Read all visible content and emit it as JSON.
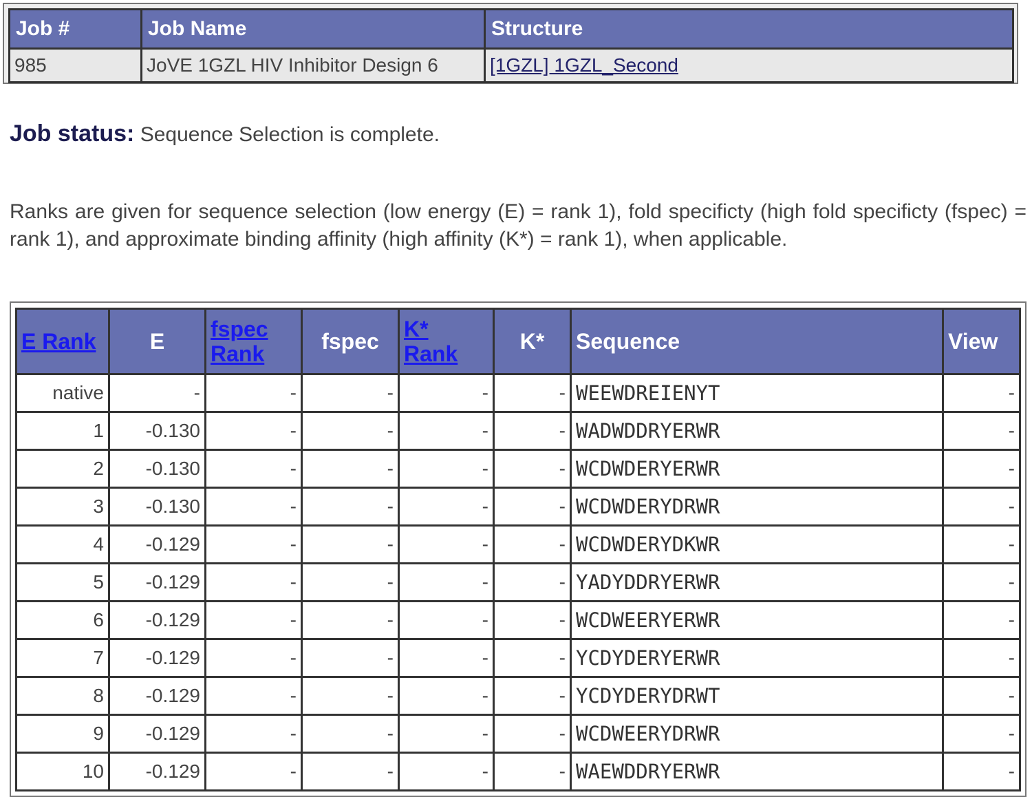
{
  "job_table": {
    "headers": [
      "Job #",
      "Job Name",
      "Structure"
    ],
    "job_number": "985",
    "job_name": "JoVE 1GZL HIV Inhibitor Design 6",
    "structure_link": "[1GZL] 1GZL_Second"
  },
  "status": {
    "label": "Job status:",
    "text": " Sequence Selection is complete."
  },
  "description": "Ranks are given for sequence selection (low energy (E) = rank 1), fold specificty (high fold specificty (fspec) = rank 1), and approximate binding affinity (high affinity (K*) = rank 1), when applicable.",
  "results": {
    "headers": {
      "e_rank": "E Rank",
      "e": "E",
      "fspec_rank_1": "fspec",
      "fspec_rank_2": "Rank",
      "fspec": "fspec",
      "kstar_rank_1": "K*",
      "kstar_rank_2": "Rank",
      "kstar": "K*",
      "sequence": "Sequence",
      "view": "View"
    },
    "rows": [
      {
        "rank": "native",
        "e": "-",
        "fspec_rank": "-",
        "fspec": "-",
        "kstar_rank": "-",
        "kstar": "-",
        "sequence": "WEEWDREIENYT",
        "view": "-"
      },
      {
        "rank": "1",
        "e": "-0.130",
        "fspec_rank": "-",
        "fspec": "-",
        "kstar_rank": "-",
        "kstar": "-",
        "sequence": "WADWDDRYERWR",
        "view": "-"
      },
      {
        "rank": "2",
        "e": "-0.130",
        "fspec_rank": "-",
        "fspec": "-",
        "kstar_rank": "-",
        "kstar": "-",
        "sequence": "WCDWDERYERWR",
        "view": "-"
      },
      {
        "rank": "3",
        "e": "-0.130",
        "fspec_rank": "-",
        "fspec": "-",
        "kstar_rank": "-",
        "kstar": "-",
        "sequence": "WCDWDERYDRWR",
        "view": "-"
      },
      {
        "rank": "4",
        "e": "-0.129",
        "fspec_rank": "-",
        "fspec": "-",
        "kstar_rank": "-",
        "kstar": "-",
        "sequence": "WCDWDERYDKWR",
        "view": "-"
      },
      {
        "rank": "5",
        "e": "-0.129",
        "fspec_rank": "-",
        "fspec": "-",
        "kstar_rank": "-",
        "kstar": "-",
        "sequence": "YADYDDRYERWR",
        "view": "-"
      },
      {
        "rank": "6",
        "e": "-0.129",
        "fspec_rank": "-",
        "fspec": "-",
        "kstar_rank": "-",
        "kstar": "-",
        "sequence": "WCDWEERYERWR",
        "view": "-"
      },
      {
        "rank": "7",
        "e": "-0.129",
        "fspec_rank": "-",
        "fspec": "-",
        "kstar_rank": "-",
        "kstar": "-",
        "sequence": "YCDYDERYERWR",
        "view": "-"
      },
      {
        "rank": "8",
        "e": "-0.129",
        "fspec_rank": "-",
        "fspec": "-",
        "kstar_rank": "-",
        "kstar": "-",
        "sequence": "YCDYDERYDRWT",
        "view": "-"
      },
      {
        "rank": "9",
        "e": "-0.129",
        "fspec_rank": "-",
        "fspec": "-",
        "kstar_rank": "-",
        "kstar": "-",
        "sequence": "WCDWEERYDRWR",
        "view": "-"
      },
      {
        "rank": "10",
        "e": "-0.129",
        "fspec_rank": "-",
        "fspec": "-",
        "kstar_rank": "-",
        "kstar": "-",
        "sequence": "WAEWDDRYERWR",
        "view": "-"
      }
    ]
  }
}
